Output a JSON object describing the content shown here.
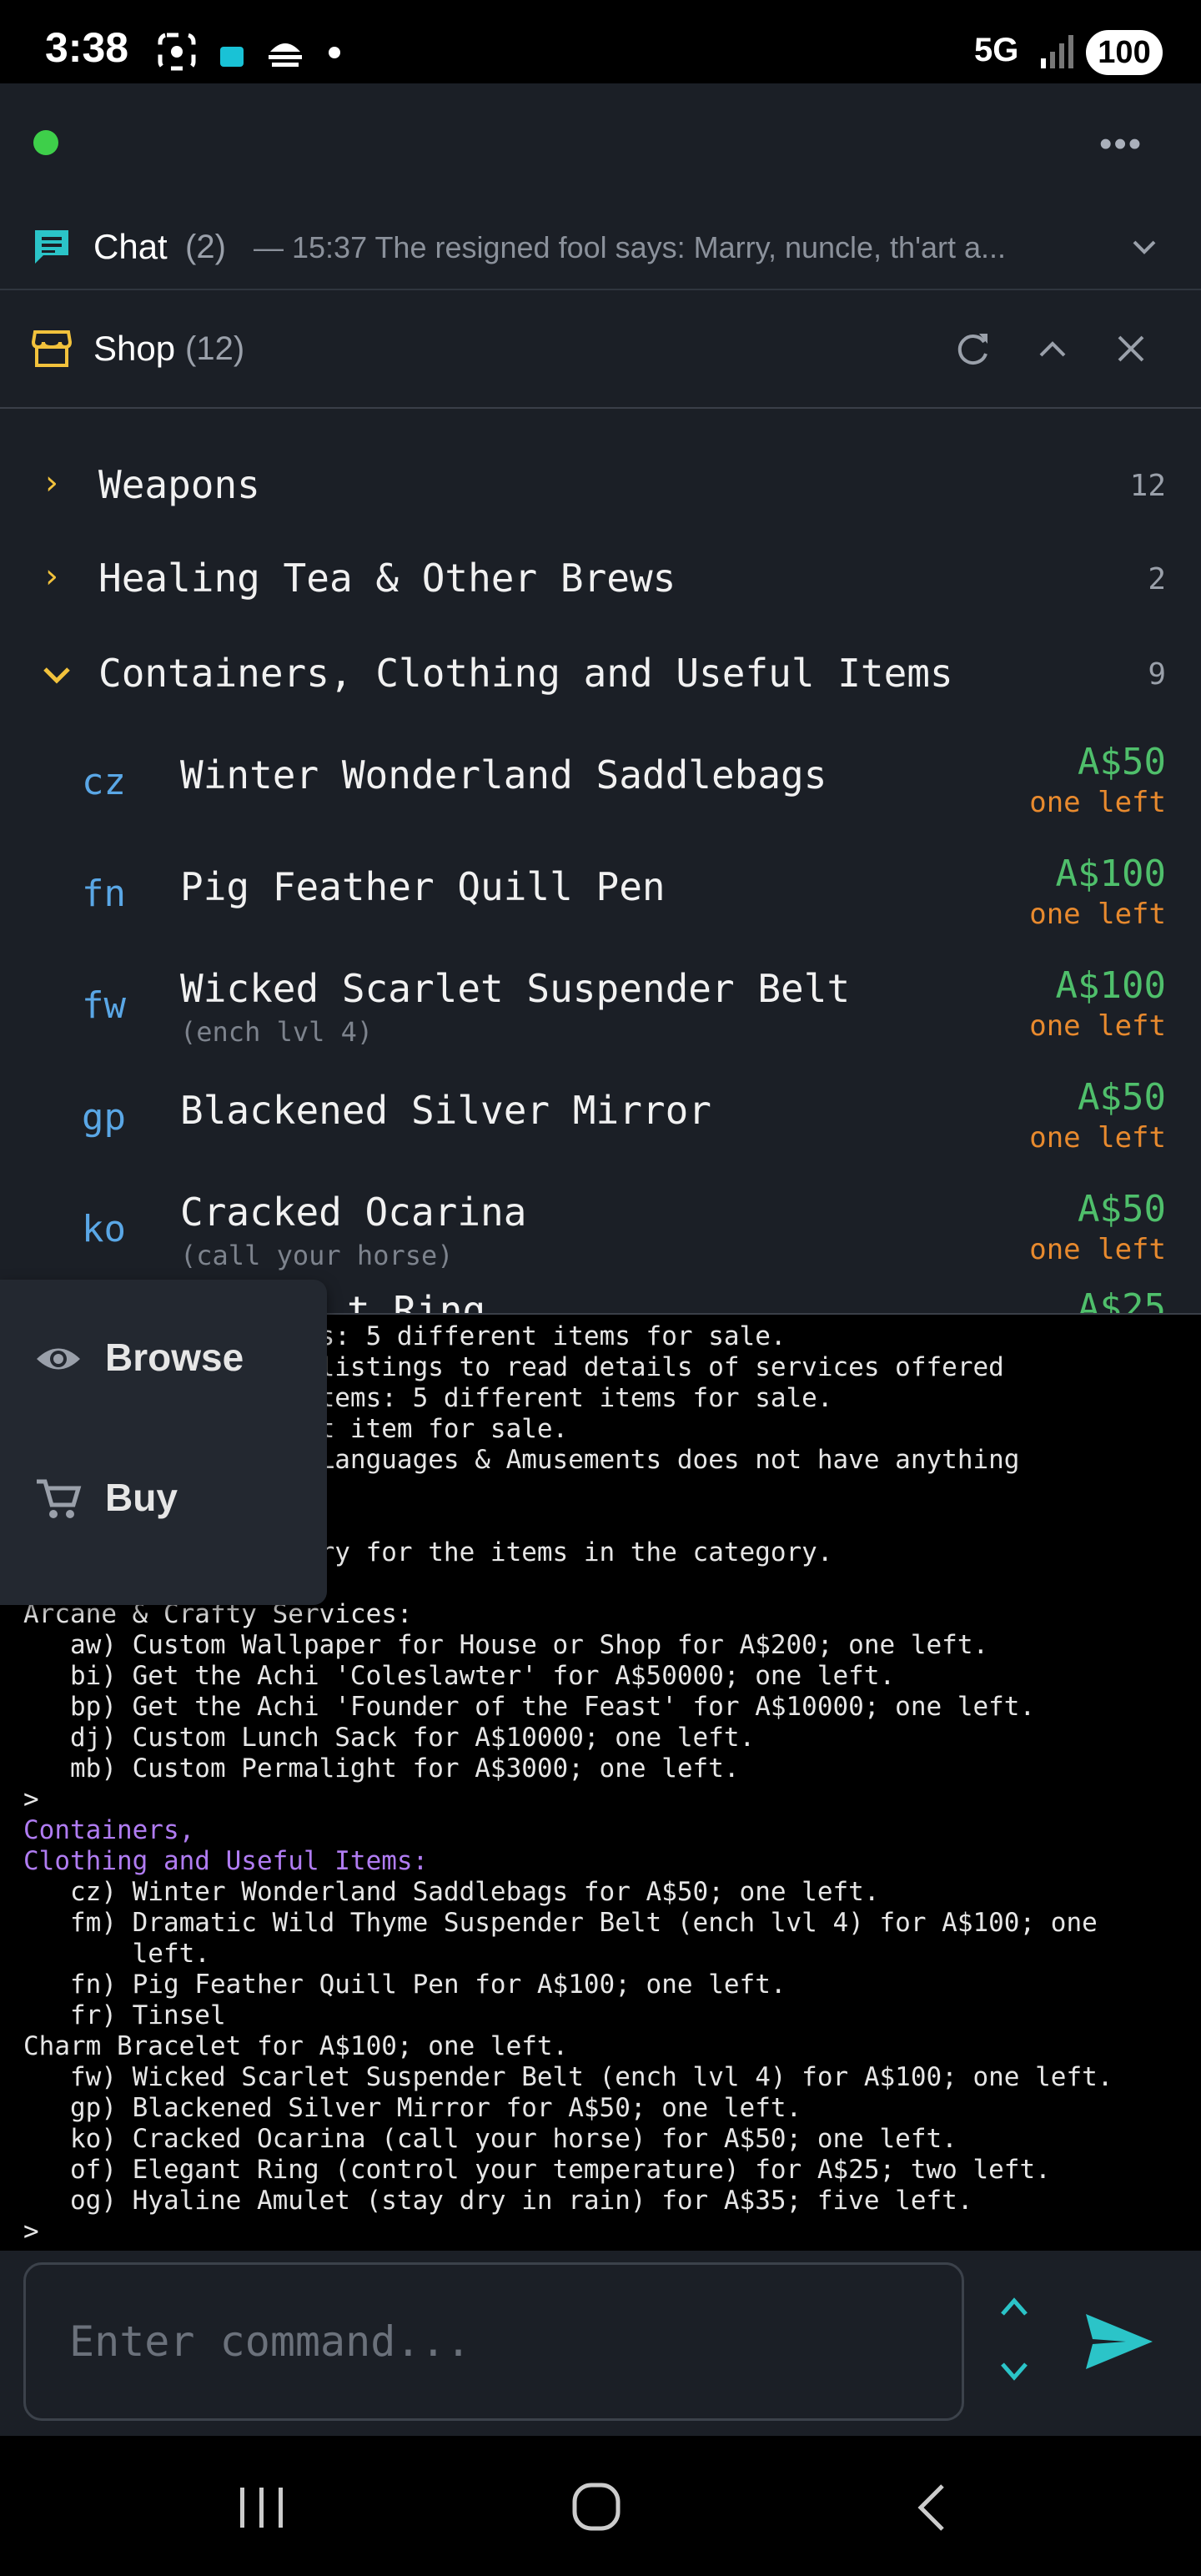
{
  "status_bar": {
    "time": "3:38",
    "network": "5G",
    "battery": "100"
  },
  "chat": {
    "label": "Chat",
    "count": "(2)",
    "snippet": "— 15:37 The resigned fool says: Marry, nuncle, th'art a..."
  },
  "shop": {
    "label": "Shop",
    "count": "(12)"
  },
  "categories": [
    {
      "name": "Weapons",
      "count": "12",
      "expanded": false
    },
    {
      "name": "Healing Tea & Other Brews",
      "count": "2",
      "expanded": false
    },
    {
      "name": "Containers, Clothing and Useful Items",
      "count": "9",
      "expanded": true
    }
  ],
  "items": [
    {
      "code": "cz",
      "name": "Winter Wonderland Saddlebags",
      "sub": "",
      "price": "A$50",
      "stock": "one left"
    },
    {
      "code": "fn",
      "name": "Pig Feather Quill Pen",
      "sub": "",
      "price": "A$100",
      "stock": "one left"
    },
    {
      "code": "fw",
      "name": "Wicked Scarlet Suspender Belt",
      "sub": "(ench lvl 4)",
      "price": "A$100",
      "stock": "one left"
    },
    {
      "code": "gp",
      "name": "Blackened Silver Mirror",
      "sub": "",
      "price": "A$50",
      "stock": "one left"
    },
    {
      "code": "ko",
      "name": "Cracked Ocarina",
      "sub": "(call your horse)",
      "price": "A$50",
      "stock": "one left"
    },
    {
      "code": "",
      "name": "t Ring",
      "sub": "",
      "price": "A$25",
      "stock": ""
    }
  ],
  "popup_menu": {
    "browse": "Browse",
    "buy": "Buy"
  },
  "terminal_lines": [
    "               vices: 5 different items for sale.",
    "               ese listings to read details of services offered",
    "               ly Items: 5 different items for sale.",
    "               erent item for sale.",
    "               ls, Languages & Amusements does not have anything",
    "",
    "",
    "               tegory for the items in the category.",
    "",
    "Arcane & Crafty Services:",
    "   aw) Custom Wallpaper for House or Shop for A$200; one left.",
    "   bi) Get the Achi 'Coleslawter' for A$50000; one left.",
    "   bp) Get the Achi 'Founder of the Feast' for A$10000; one left.",
    "   dj) Custom Lunch Sack for A$10000; one left.",
    "   mb) Custom Permalight for A$3000; one left.",
    ">",
    "Containers,",
    "Clothing and Useful Items:",
    "   cz) Winter Wonderland Saddlebags for A$50; one left.",
    "   fm) Dramatic Wild Thyme Suspender Belt (ench lvl 4) for A$100; one",
    "       left.",
    "   fn) Pig Feather Quill Pen for A$100; one left.",
    "   fr) Tinsel",
    "Charm Bracelet for A$100; one left.",
    "   fw) Wicked Scarlet Suspender Belt (ench lvl 4) for A$100; one left.",
    "   gp) Blackened Silver Mirror for A$50; one left.",
    "   ko) Cracked Ocarina (call your horse) for A$50; one left.",
    "   of) Elegant Ring (control your temperature) for A$25; two left.",
    "   og) Hyaline Amulet (stay dry in rain) for A$35; five left.",
    ">"
  ],
  "input": {
    "placeholder": "Enter command..."
  },
  "colors": {
    "accent": "#2bc4c8",
    "price": "#4fbf6b",
    "stock": "#e88a2e",
    "code": "#5aa7e6",
    "chevron": "#f2c23c"
  }
}
